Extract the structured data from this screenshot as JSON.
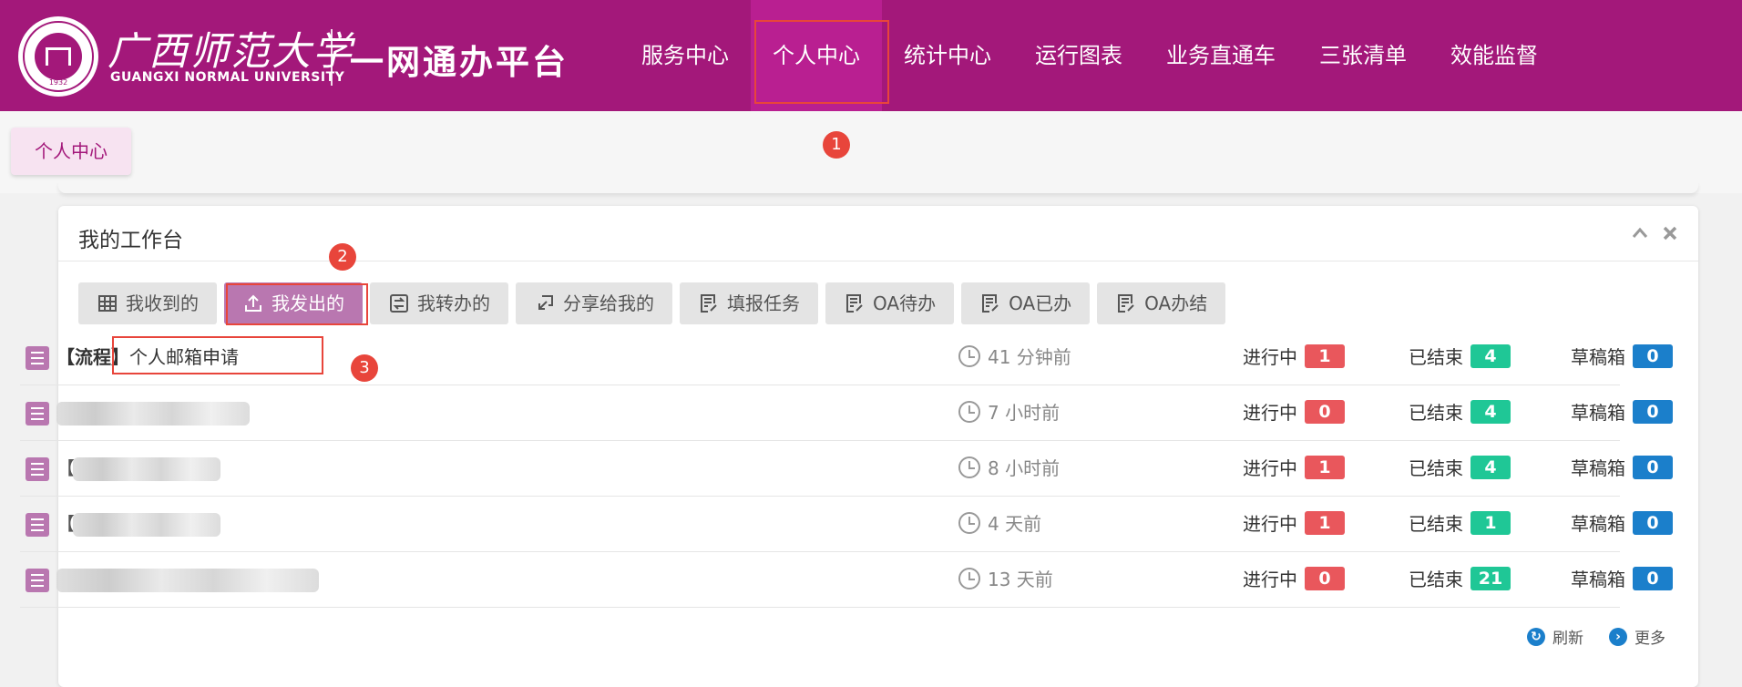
{
  "header": {
    "logo_cn": "广西师范大学",
    "logo_en": "GUANGXI NORMAL UNIVERSITY",
    "emblem_year": "1932",
    "platform_title": "一网通办平台",
    "nav": [
      {
        "label": "服务中心",
        "active": false
      },
      {
        "label": "个人中心",
        "active": true
      },
      {
        "label": "统计中心",
        "active": false
      },
      {
        "label": "运行图表",
        "active": false
      },
      {
        "label": "业务直通车",
        "active": false
      },
      {
        "label": "三张清单",
        "active": false
      },
      {
        "label": "效能监督",
        "active": false
      }
    ],
    "brand_color": "#a3187a"
  },
  "breadcrumb": {
    "current": "个人中心"
  },
  "workbench": {
    "title": "我的工作台",
    "collapse_icon": "chevron-up-icon",
    "close_icon": "close-icon",
    "tabs": [
      {
        "label": "我收到的",
        "icon": "grid-table-icon",
        "active": false
      },
      {
        "label": "我发出的",
        "icon": "upload-icon",
        "active": true
      },
      {
        "label": "我转办的",
        "icon": "transfer-icon",
        "active": false
      },
      {
        "label": "分享给我的",
        "icon": "share-icon",
        "active": false
      },
      {
        "label": "填报任务",
        "icon": "form-icon",
        "active": false
      },
      {
        "label": "OA待办",
        "icon": "form-icon",
        "active": false
      },
      {
        "label": "OA已办",
        "icon": "form-icon",
        "active": false
      },
      {
        "label": "OA办结",
        "icon": "form-icon",
        "active": false
      }
    ],
    "status_labels": {
      "in_progress": "进行中",
      "finished": "已结束",
      "draft": "草稿箱"
    },
    "rows": [
      {
        "prefix": "【流程】",
        "title": "个人邮箱申请",
        "time": "41 分钟前",
        "in_progress": "1",
        "finished": "4",
        "draft": "0",
        "blurred": false
      },
      {
        "prefix": "",
        "title": "",
        "time": "7 小时前",
        "in_progress": "0",
        "finished": "4",
        "draft": "0",
        "blurred": true
      },
      {
        "prefix": "【",
        "title": "",
        "time": "8 小时前",
        "in_progress": "1",
        "finished": "4",
        "draft": "0",
        "blurred": true
      },
      {
        "prefix": "【",
        "title": "",
        "time": "4 天前",
        "in_progress": "1",
        "finished": "1",
        "draft": "0",
        "blurred": true
      },
      {
        "prefix": "",
        "title": "",
        "time": "13 天前",
        "in_progress": "0",
        "finished": "21",
        "draft": "0",
        "blurred": true
      }
    ],
    "footer": {
      "refresh": "刷新",
      "more": "更多"
    }
  },
  "annotations": [
    "1",
    "2",
    "3"
  ],
  "colors": {
    "badge_red": "#e9575c",
    "badge_green": "#1fc796",
    "badge_blue": "#1b7fcb",
    "annotation": "#e8453b"
  }
}
